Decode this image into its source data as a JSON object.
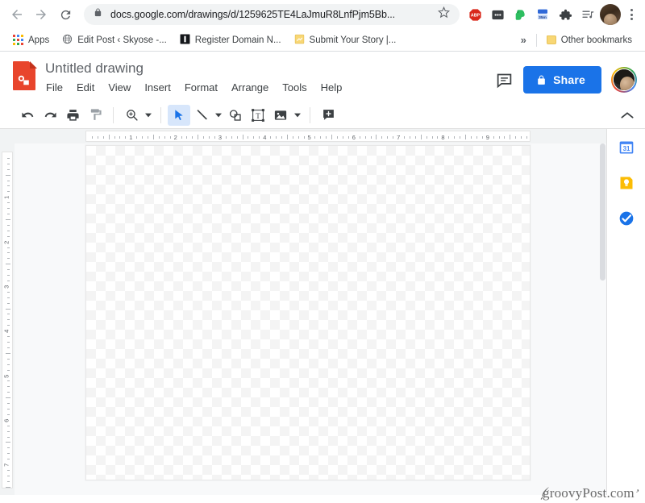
{
  "browser": {
    "nav": {
      "back_label": "Back",
      "forward_label": "Forward",
      "reload_label": "Reload"
    },
    "omnibox": {
      "url": "docs.google.com/drawings/d/1259625TE4LaJmuR8LnfPjm5Bb...",
      "lock_icon": "lock-icon",
      "star_icon": "star-icon"
    },
    "extensions": [
      {
        "name": "adblock-plus-extension",
        "label": "ABP"
      },
      {
        "name": "dots-extension",
        "label": ""
      },
      {
        "name": "evernote-extension",
        "label": ""
      },
      {
        "name": "time-tracker-extension",
        "label": "35m"
      },
      {
        "name": "extensions-puzzle-icon",
        "label": ""
      },
      {
        "name": "media-playlist-icon",
        "label": ""
      }
    ],
    "profile_label": "Profile",
    "chrome_menu_label": "Customize and control Google Chrome",
    "bookmarks": [
      {
        "name": "apps",
        "label": "Apps",
        "icon": "apps-grid-icon"
      },
      {
        "name": "edit-post-skyose",
        "label": "Edit Post ‹ Skyose -...",
        "icon": "globe-icon"
      },
      {
        "name": "register-domain",
        "label": "Register Domain N...",
        "icon": "dark-square-icon"
      },
      {
        "name": "submit-your-story",
        "label": "Submit Your Story |...",
        "icon": "page-icon"
      }
    ],
    "bookmarks_overflow": "»",
    "other_bookmarks": "Other bookmarks"
  },
  "app": {
    "doc_title": "Untitled drawing",
    "logo_name": "google-drawings-logo",
    "menus": [
      "File",
      "Edit",
      "View",
      "Insert",
      "Format",
      "Arrange",
      "Tools",
      "Help"
    ],
    "comment_label": "Open comment history",
    "share_label": "Share",
    "share_color": "#1a73e8",
    "account_label": "Google Account"
  },
  "toolbar": {
    "items": [
      {
        "name": "undo-button",
        "icon": "undo-icon",
        "caret": false
      },
      {
        "name": "redo-button",
        "icon": "redo-icon",
        "caret": false
      },
      {
        "name": "print-button",
        "icon": "print-icon",
        "caret": false
      },
      {
        "name": "paint-format-button",
        "icon": "paint-format-icon",
        "caret": false
      },
      {
        "name": "zoom-button",
        "icon": "zoom-in-icon",
        "caret": true
      },
      {
        "name": "select-button",
        "icon": "cursor-arrow-icon",
        "caret": false,
        "active": true
      },
      {
        "name": "line-button",
        "icon": "line-icon",
        "caret": true
      },
      {
        "name": "shape-button",
        "icon": "shape-icon",
        "caret": false
      },
      {
        "name": "text-box-button",
        "icon": "text-box-icon",
        "caret": false
      },
      {
        "name": "image-button",
        "icon": "image-icon",
        "caret": true
      },
      {
        "name": "comment-button",
        "icon": "add-comment-icon",
        "caret": false
      }
    ],
    "collapse_label": "Hide the menus",
    "active_tool": "select-button"
  },
  "rulers": {
    "horizontal_labels": [
      "1",
      "2",
      "3",
      "4",
      "5",
      "6",
      "7",
      "8",
      "9"
    ],
    "vertical_labels": [
      "1",
      "2",
      "3",
      "4",
      "5",
      "6",
      "7"
    ],
    "units": "inches"
  },
  "canvas": {
    "name": "drawing-canvas",
    "state": "empty-transparent"
  },
  "right_rail": [
    {
      "name": "google-calendar-icon",
      "label": "31"
    },
    {
      "name": "google-keep-icon",
      "label": ""
    },
    {
      "name": "google-tasks-icon",
      "label": ""
    }
  ],
  "watermark": "groovyPost.com"
}
